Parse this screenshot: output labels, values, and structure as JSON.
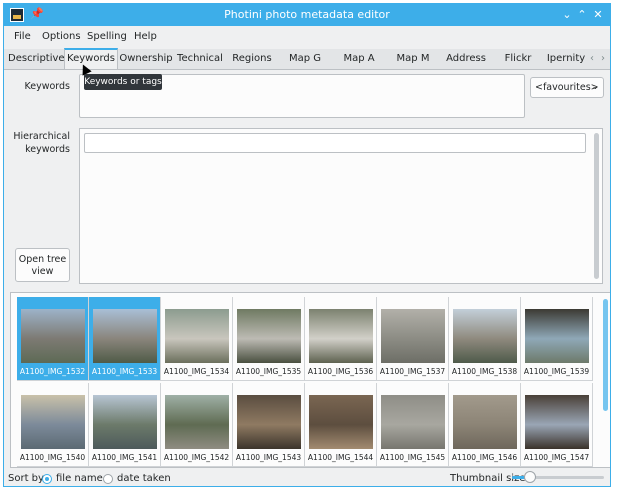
{
  "window": {
    "title": "Photini photo metadata editor"
  },
  "menu": [
    "File",
    "Options",
    "Spelling",
    "Help"
  ],
  "tabs": [
    "Descriptive",
    "Keywords",
    "Ownership",
    "Technical",
    "Regions",
    "Map G",
    "Map A",
    "Map M",
    "Address",
    "Flickr",
    "Ipernity"
  ],
  "active_tab": "Keywords",
  "tooltip": "Keywords or tags",
  "keywords": {
    "label": "Keywords",
    "value": "",
    "favourites": "<favourites>"
  },
  "hierarchical": {
    "label": "Hierarchical keywords",
    "value": "",
    "open_tree_view": "Open tree view"
  },
  "thumbnails": [
    {
      "name": "A1100_IMG_1532",
      "selected": true
    },
    {
      "name": "A1100_IMG_1533",
      "selected": true
    },
    {
      "name": "A1100_IMG_1534",
      "selected": false
    },
    {
      "name": "A1100_IMG_1535",
      "selected": false
    },
    {
      "name": "A1100_IMG_1536",
      "selected": false
    },
    {
      "name": "A1100_IMG_1537",
      "selected": false
    },
    {
      "name": "A1100_IMG_1538",
      "selected": false
    },
    {
      "name": "A1100_IMG_1539",
      "selected": false
    },
    {
      "name": "A1100_IMG_1540",
      "selected": false
    },
    {
      "name": "A1100_IMG_1541",
      "selected": false
    },
    {
      "name": "A1100_IMG_1542",
      "selected": false
    },
    {
      "name": "A1100_IMG_1543",
      "selected": false
    },
    {
      "name": "A1100_IMG_1544",
      "selected": false
    },
    {
      "name": "A1100_IMG_1545",
      "selected": false
    },
    {
      "name": "A1100_IMG_1546",
      "selected": false
    },
    {
      "name": "A1100_IMG_1547",
      "selected": false
    }
  ],
  "status": {
    "sort_by": "Sort by",
    "file_name": "file name",
    "date_taken": "date taken",
    "sort_selected": "file name",
    "thumbnail_size": "Thumbnail size",
    "thumbnail_size_level": 0.2
  },
  "colors": {
    "accent": "#3daee9",
    "window_bg": "#eff0f1",
    "text": "#232627"
  },
  "icons": {
    "app": "photini-app-icon",
    "pin": "pin-icon",
    "minimize": "chevron-down-icon",
    "maximize": "chevron-up-icon",
    "close": "close-icon"
  }
}
